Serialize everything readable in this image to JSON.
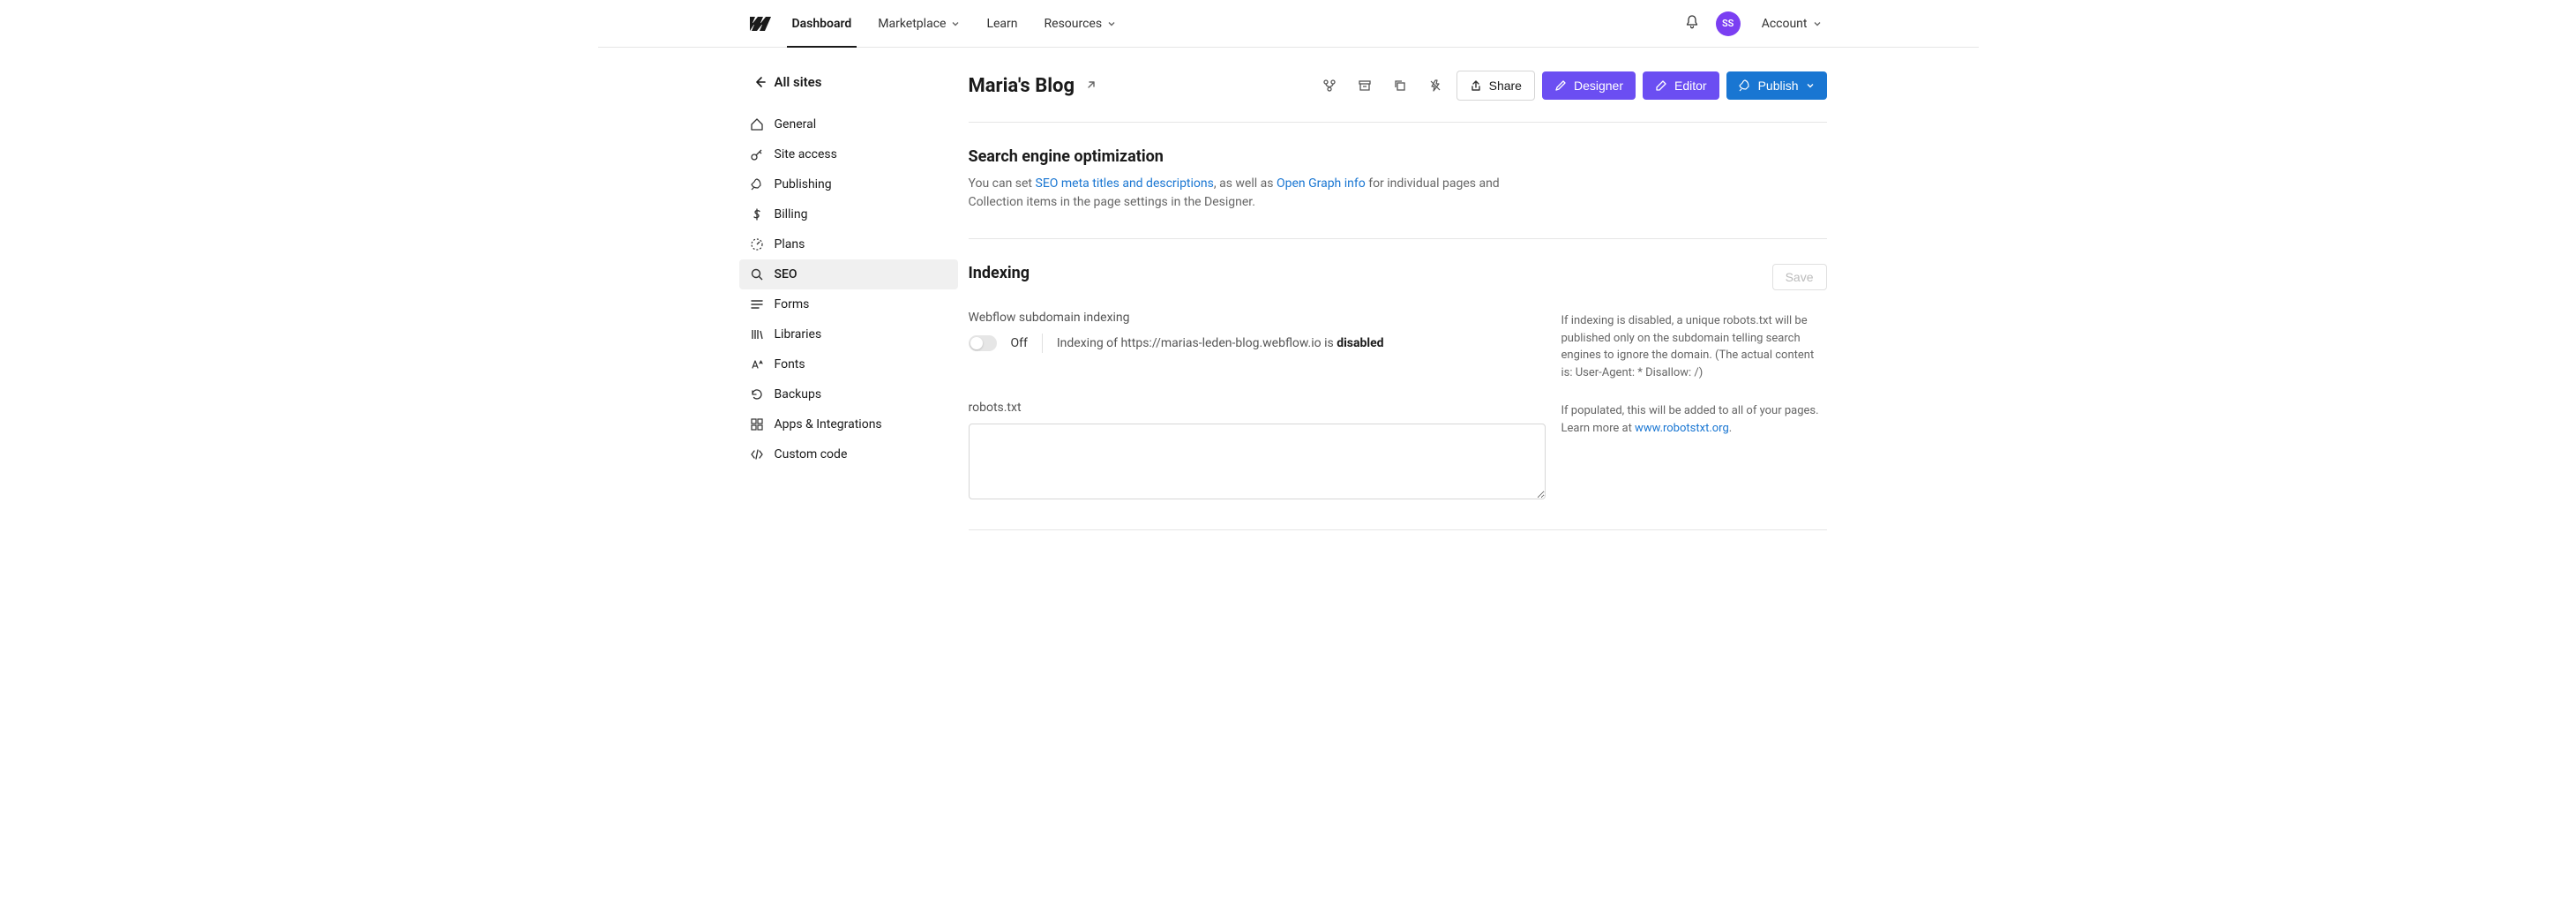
{
  "topnav": {
    "items": [
      "Dashboard",
      "Marketplace",
      "Learn",
      "Resources"
    ],
    "avatar": "SS",
    "account": "Account"
  },
  "sidebar": {
    "back": "All sites",
    "items": [
      {
        "label": "General"
      },
      {
        "label": "Site access"
      },
      {
        "label": "Publishing"
      },
      {
        "label": "Billing"
      },
      {
        "label": "Plans"
      },
      {
        "label": "SEO"
      },
      {
        "label": "Forms"
      },
      {
        "label": "Libraries"
      },
      {
        "label": "Fonts"
      },
      {
        "label": "Backups"
      },
      {
        "label": "Apps & Integrations"
      },
      {
        "label": "Custom code"
      }
    ]
  },
  "page": {
    "title": "Maria's Blog",
    "share": "Share",
    "designer": "Designer",
    "editor": "Editor",
    "publish": "Publish"
  },
  "seo": {
    "heading": "Search engine optimization",
    "desc_pre": "You can set ",
    "desc_link1": "SEO meta titles and descriptions",
    "desc_mid": ", as well as ",
    "desc_link2": "Open Graph info",
    "desc_post": " for individual pages and Collection items in the page settings in the Designer."
  },
  "indexing": {
    "heading": "Indexing",
    "save": "Save",
    "subdomain_label": "Webflow subdomain indexing",
    "toggle_state": "Off",
    "toggle_desc_pre": "Indexing of https://marias-leden-blog.webflow.io is ",
    "toggle_desc_status": "disabled",
    "help1": "If indexing is disabled, a unique robots.txt will be published only on the subdomain telling search engines to ignore the domain. (The actual content is: User-Agent: * Disallow: /)",
    "robots_label": "robots.txt",
    "robots_value": "",
    "help2_pre": "If populated, this will be added to all of your pages. Learn more at ",
    "help2_link": "www.robotstxt.org",
    "help2_post": "."
  }
}
